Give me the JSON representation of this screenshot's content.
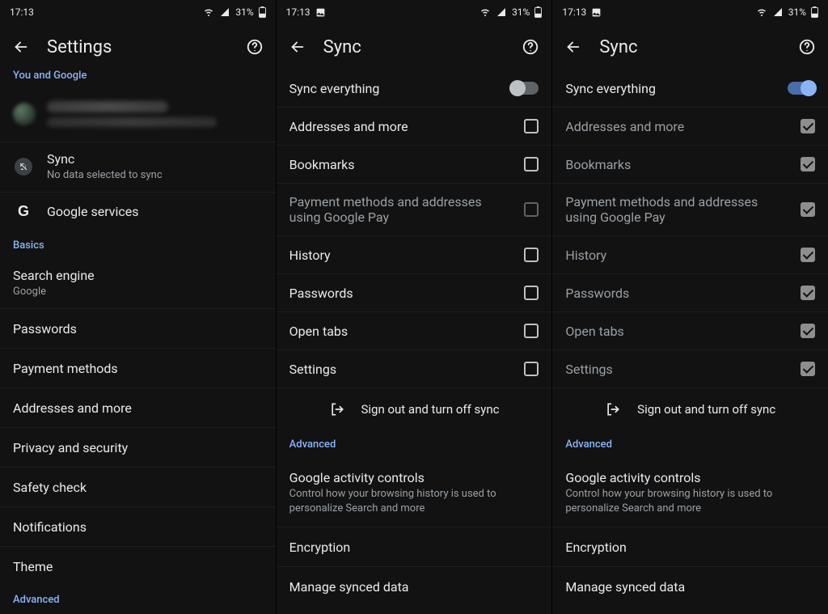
{
  "status": {
    "time": "17:13",
    "battery_pct": "31%",
    "image_badge": true
  },
  "panels": {
    "settings": {
      "title": "Settings",
      "sections": {
        "you_and_google": "You and Google",
        "basics": "Basics",
        "advanced": "Advanced"
      },
      "sync_row": {
        "title": "Sync",
        "subtitle": "No data selected to sync"
      },
      "google_services": "Google services",
      "search_engine": {
        "title": "Search engine",
        "value": "Google"
      },
      "passwords": "Passwords",
      "payment_methods": "Payment methods",
      "addresses": "Addresses and more",
      "privacy": "Privacy and security",
      "safety": "Safety check",
      "notifications": "Notifications",
      "theme": "Theme"
    },
    "sync_off": {
      "title": "Sync",
      "sync_everything": "Sync everything",
      "items": {
        "addresses": "Addresses and more",
        "bookmarks": "Bookmarks",
        "pay": "Payment methods and addresses using Google Pay",
        "history": "History",
        "passwords": "Passwords",
        "open_tabs": "Open tabs",
        "settings": "Settings"
      },
      "signout": "Sign out and turn off sync",
      "advanced_hdr": "Advanced",
      "activity": {
        "title": "Google activity controls",
        "sub": "Control how your browsing history is used to personalize Search and more"
      },
      "encryption": "Encryption",
      "manage": "Manage synced data"
    },
    "sync_on": {
      "title": "Sync",
      "sync_everything": "Sync everything",
      "items": {
        "addresses": "Addresses and more",
        "bookmarks": "Bookmarks",
        "pay": "Payment methods and addresses using Google Pay",
        "history": "History",
        "passwords": "Passwords",
        "open_tabs": "Open tabs",
        "settings": "Settings"
      },
      "signout": "Sign out and turn off sync",
      "advanced_hdr": "Advanced",
      "activity": {
        "title": "Google activity controls",
        "sub": "Control how your browsing history is used to personalize Search and more"
      },
      "encryption": "Encryption",
      "manage": "Manage synced data"
    }
  }
}
